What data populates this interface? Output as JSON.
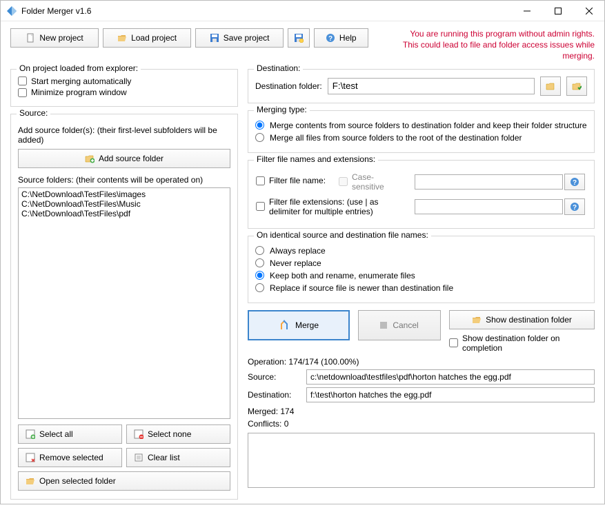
{
  "window": {
    "title": "Folder Merger v1.6"
  },
  "toolbar": {
    "new_project": "New project",
    "load_project": "Load project",
    "save_project": "Save project",
    "help": "Help"
  },
  "warning": {
    "line1": "You are running this program without admin rights.",
    "line2": "This could lead to file and folder access issues while merging."
  },
  "explorer": {
    "legend": "On project loaded from explorer:",
    "start_merging": "Start merging automatically",
    "minimize": "Minimize program window"
  },
  "source": {
    "legend": "Source:",
    "add_hint": "Add source folder(s): (their first-level subfolders will be added)",
    "add_btn": "Add source folder",
    "list_label": "Source folders: (their contents will be operated on)",
    "folders": [
      "C:\\NetDownload\\TestFiles\\images",
      "C:\\NetDownload\\TestFiles\\Music",
      "C:\\NetDownload\\TestFiles\\pdf"
    ],
    "select_all": "Select all",
    "select_none": "Select none",
    "remove_selected": "Remove selected",
    "clear_list": "Clear list",
    "open_selected": "Open selected folder"
  },
  "destination": {
    "legend": "Destination:",
    "label": "Destination folder:",
    "value": "F:\\test"
  },
  "merging_type": {
    "legend": "Merging type:",
    "opt1": "Merge contents from source folders to destination folder and keep their folder structure",
    "opt2": "Merge all files from source folders to the root of the destination folder",
    "selected": 0
  },
  "filter": {
    "legend": "Filter file names and extensions:",
    "filter_name": "Filter file name:",
    "case_sensitive": "Case-sensitive",
    "filter_ext": "Filter file extensions: (use | as delimiter for multiple entries)"
  },
  "identical": {
    "legend": "On identical source and destination file names:",
    "opt1": "Always replace",
    "opt2": "Never replace",
    "opt3": "Keep both and rename, enumerate files",
    "opt4": "Replace if source file is newer than destination file",
    "selected": 2
  },
  "actions": {
    "merge": "Merge",
    "cancel": "Cancel",
    "show_dest": "Show destination folder",
    "show_dest_on_completion": "Show destination folder on completion"
  },
  "operation": {
    "label": "Operation:",
    "value": "174/174 (100.00%)",
    "source_label": "Source:",
    "source_value": "c:\\netdownload\\testfiles\\pdf\\horton hatches the egg.pdf",
    "dest_label": "Destination:",
    "dest_value": "f:\\test\\horton hatches the egg.pdf",
    "merged_label": "Merged:",
    "merged_value": "174",
    "conflicts_label": "Conflicts:",
    "conflicts_value": "0"
  },
  "icons": {
    "new": "new",
    "load": "load",
    "save": "save",
    "disk": "disk",
    "help": "help",
    "folder_add": "folder_add",
    "select_all": "select_all",
    "select_none": "select_none",
    "remove": "remove",
    "clear": "clear",
    "folder_open": "folder_open",
    "browse": "browse",
    "check_folder": "check_folder",
    "merge": "merge",
    "stop": "stop"
  }
}
